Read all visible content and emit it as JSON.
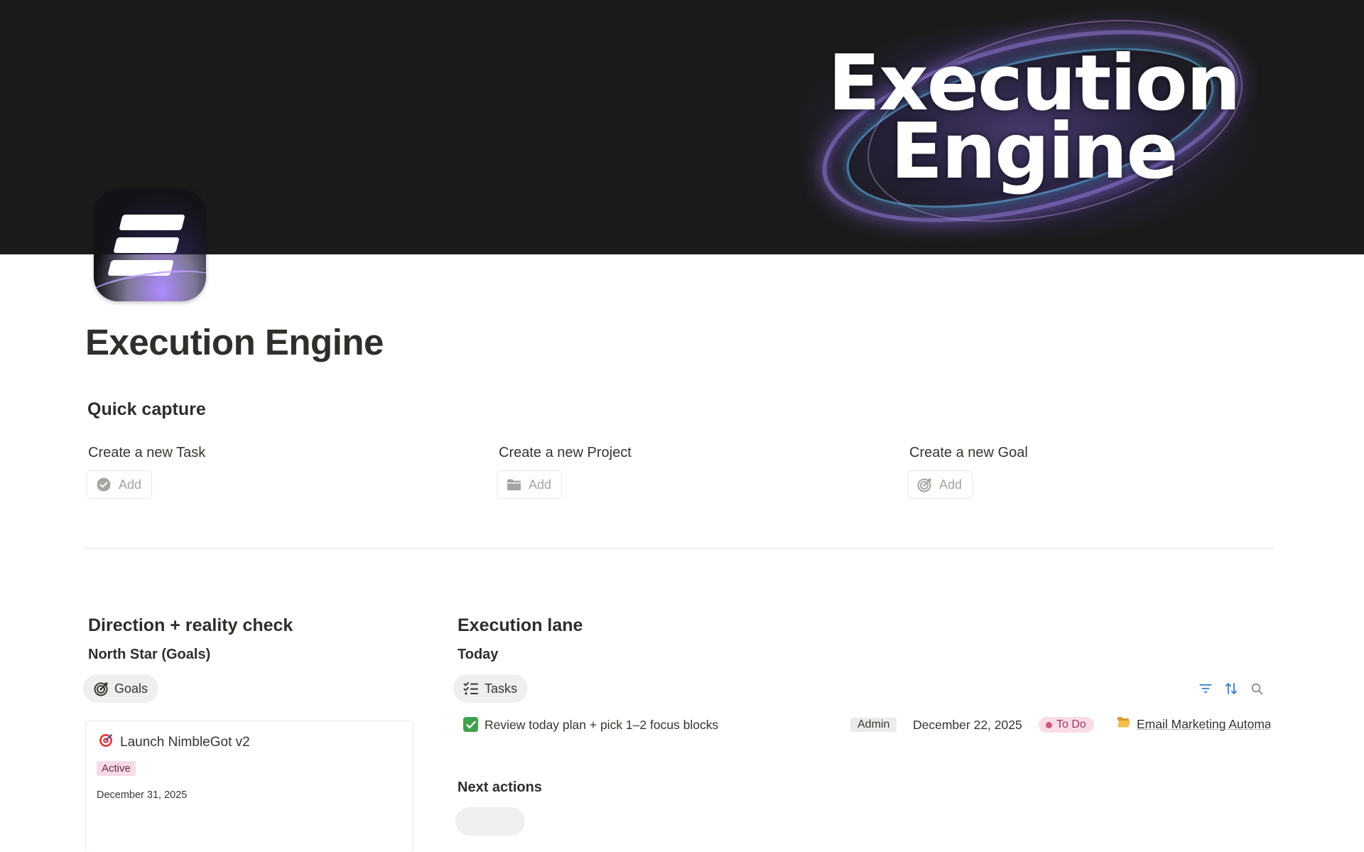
{
  "cover": {
    "title_line1": "Execution",
    "title_line2": "Engine"
  },
  "page": {
    "title": "Execution Engine"
  },
  "quick_capture": {
    "heading": "Quick capture",
    "items": [
      {
        "label": "Create a new Task",
        "button": "Add",
        "icon": "check-circle-icon"
      },
      {
        "label": "Create a new Project",
        "button": "Add",
        "icon": "folder-icon"
      },
      {
        "label": "Create a new Goal",
        "button": "Add",
        "icon": "target-icon"
      }
    ]
  },
  "direction": {
    "heading": "Direction + reality check",
    "subheading": "North Star (Goals)",
    "tab": {
      "label": "Goals",
      "icon": "target-icon"
    },
    "card": {
      "icon": "dart-icon",
      "title": "Launch NimbleGot v2",
      "status": "Active",
      "date": "December 31, 2025"
    }
  },
  "execution": {
    "heading": "Execution lane",
    "today_heading": "Today",
    "tab": {
      "label": "Tasks",
      "icon": "checklist-icon"
    },
    "toolbar": {
      "filter_icon": "filter-icon",
      "sort_icon": "sort-icon",
      "search_icon": "search-icon"
    },
    "task": {
      "name": "Review today plan + pick 1–2 focus blocks",
      "area": "Admin",
      "due": "December 22, 2025",
      "status": "To Do",
      "project": "Email Marketing Automation"
    },
    "next_heading": "Next actions"
  },
  "colors": {
    "accent_blue": "#2f80c8",
    "status_pink": "#d1577f",
    "check_green": "#3fa14f"
  }
}
